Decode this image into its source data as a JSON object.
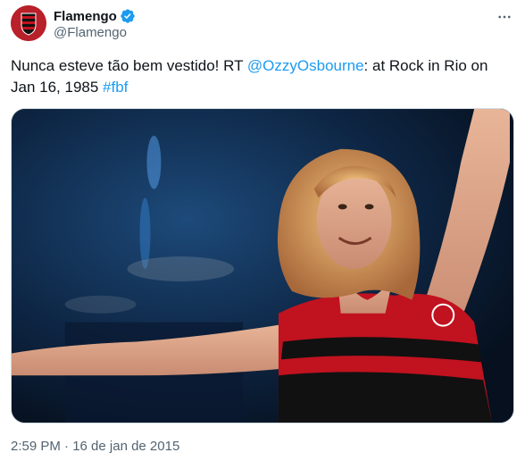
{
  "author": {
    "name": "Flamengo",
    "handle": "@Flamengo"
  },
  "tweet": {
    "text_before": "Nunca esteve tão bem vestido! RT ",
    "mention": "@OzzyOsbourne",
    "text_middle": ": at Rock in Rio on Jan 16, 1985 ",
    "hashtag": "#fbf",
    "timestamp": "2:59 PM · 16 de jan de 2015"
  },
  "icons": {
    "verified": "verified-badge-icon",
    "more": "more-options-icon"
  },
  "colors": {
    "link": "#1d9bf0",
    "verified": "#1d9bf0",
    "secondary_text": "#536471",
    "flamengo_red": "#c1121f",
    "flamengo_black": "#111111"
  }
}
